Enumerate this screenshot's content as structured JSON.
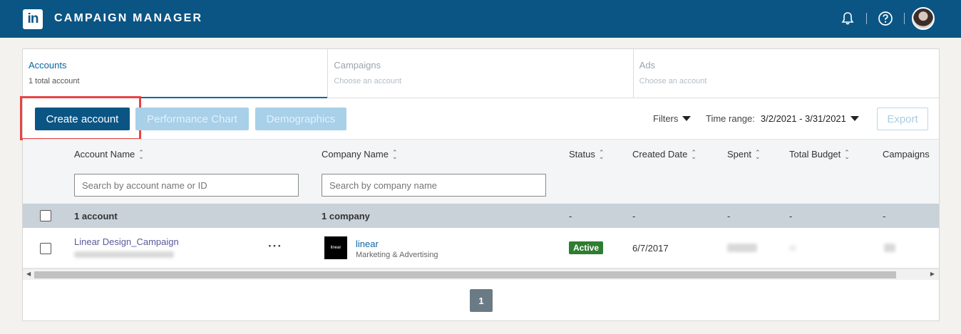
{
  "header": {
    "logo_text": "in",
    "title": "CAMPAIGN MANAGER"
  },
  "tabs": [
    {
      "label": "Accounts",
      "sub": "1 total account",
      "active": true
    },
    {
      "label": "Campaigns",
      "sub": "Choose an account",
      "active": false
    },
    {
      "label": "Ads",
      "sub": "Choose an account",
      "active": false
    }
  ],
  "toolbar": {
    "create_label": "Create account",
    "performance_label": "Performance Chart",
    "demographics_label": "Demographics",
    "filters_label": "Filters",
    "time_range_label": "Time range:",
    "time_range_value": "3/2/2021 - 3/31/2021",
    "export_label": "Export"
  },
  "table": {
    "columns": {
      "account_name": "Account Name",
      "company_name": "Company Name",
      "status": "Status",
      "created_date": "Created Date",
      "spent": "Spent",
      "total_budget": "Total Budget",
      "campaigns": "Campaigns"
    },
    "search_account_placeholder": "Search by account name or ID",
    "search_company_placeholder": "Search by company name",
    "summary": {
      "accounts": "1 account",
      "companies": "1 company",
      "dash": "-"
    },
    "rows": [
      {
        "account_name": "Linear Design_Campaign",
        "more": "···",
        "company_logo_text": "linear",
        "company_name": "linear",
        "company_industry": "Marketing & Advertising",
        "status": "Active",
        "created_date": "6/7/2017"
      }
    ]
  },
  "pagination": {
    "current_page": "1"
  },
  "colors": {
    "brand": "#0a5584",
    "active_status": "#2e7d32",
    "highlight": "#e64444"
  }
}
